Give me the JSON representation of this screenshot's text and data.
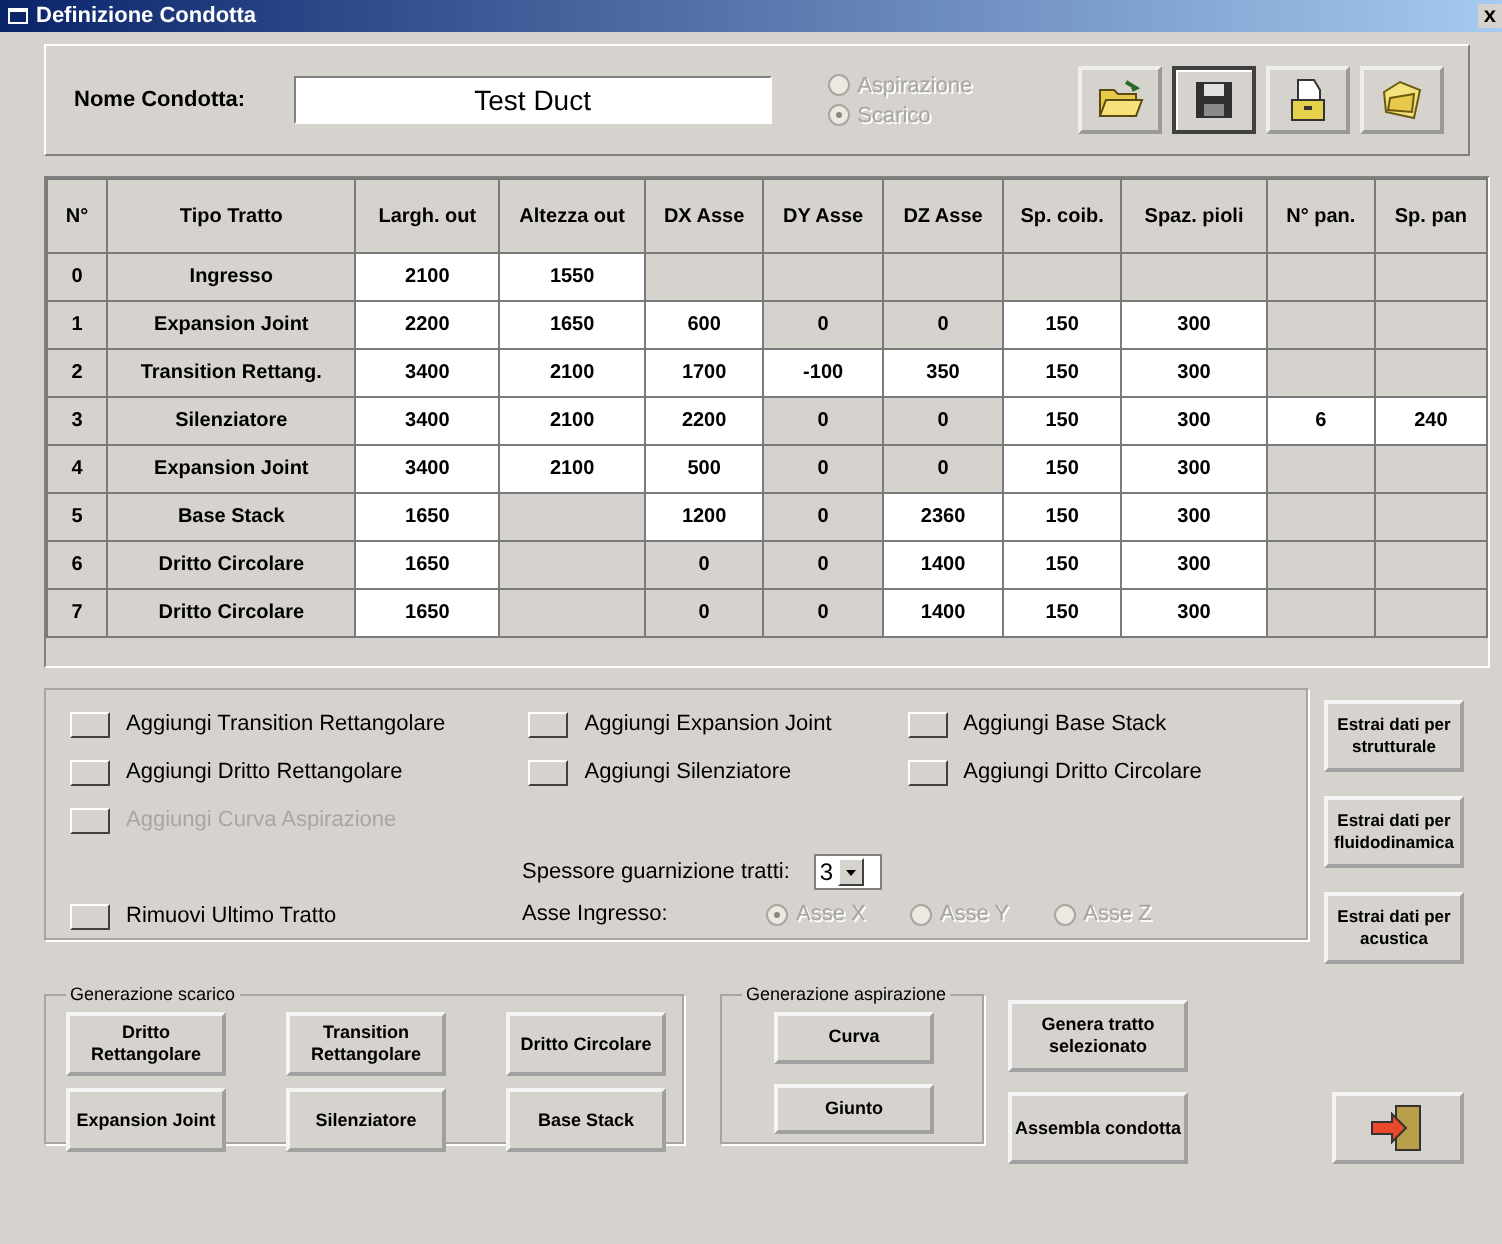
{
  "window": {
    "title": "Definizione Condotta",
    "close": "x"
  },
  "header": {
    "name_label": "Nome Condotta:",
    "name_value": "Test Duct",
    "mode_options": [
      {
        "label": "Aspirazione",
        "selected": false,
        "disabled": true
      },
      {
        "label": "Scarico",
        "selected": true,
        "disabled": true
      }
    ],
    "tool_buttons": [
      {
        "kind": "open",
        "pressed": false
      },
      {
        "kind": "save",
        "pressed": true
      },
      {
        "kind": "archive",
        "pressed": false
      },
      {
        "kind": "folder",
        "pressed": false
      }
    ]
  },
  "table": {
    "columns": [
      "N°",
      "Tipo Tratto",
      "Largh. out",
      "Altezza out",
      "DX Asse",
      "DY Asse",
      "DZ Asse",
      "Sp. coib.",
      "Spaz. pioli",
      "N° pan.",
      "Sp. pan"
    ],
    "rows": [
      {
        "cells": [
          {
            "text": "0",
            "editable": false
          },
          {
            "text": "Ingresso",
            "editable": false
          },
          {
            "text": "2100",
            "editable": true
          },
          {
            "text": "1550",
            "editable": true
          },
          {
            "editable": false
          },
          {
            "editable": false
          },
          {
            "editable": false
          },
          {
            "editable": false
          },
          {
            "editable": false
          },
          {
            "editable": false
          },
          {
            "editable": false
          }
        ]
      },
      {
        "cells": [
          {
            "text": "1",
            "editable": false
          },
          {
            "text": "Expansion Joint",
            "editable": false
          },
          {
            "text": "2200",
            "editable": true
          },
          {
            "text": "1650",
            "editable": true
          },
          {
            "text": "600",
            "editable": true
          },
          {
            "text": "0",
            "editable": false
          },
          {
            "text": "0",
            "editable": false
          },
          {
            "text": "150",
            "editable": true
          },
          {
            "text": "300",
            "editable": true
          },
          {
            "editable": false
          },
          {
            "editable": false
          }
        ]
      },
      {
        "cells": [
          {
            "text": "2",
            "editable": false
          },
          {
            "text": "Transition Rettang.",
            "editable": false
          },
          {
            "text": "3400",
            "editable": true
          },
          {
            "text": "2100",
            "editable": true
          },
          {
            "text": "1700",
            "editable": true
          },
          {
            "text": "-100",
            "editable": true
          },
          {
            "text": "350",
            "editable": true
          },
          {
            "text": "150",
            "editable": true
          },
          {
            "text": "300",
            "editable": true
          },
          {
            "editable": false
          },
          {
            "editable": false
          }
        ]
      },
      {
        "cells": [
          {
            "text": "3",
            "editable": false
          },
          {
            "text": "Silenziatore",
            "editable": false
          },
          {
            "text": "3400",
            "editable": true
          },
          {
            "text": "2100",
            "editable": true
          },
          {
            "text": "2200",
            "editable": true
          },
          {
            "text": "0",
            "editable": false
          },
          {
            "text": "0",
            "editable": false
          },
          {
            "text": "150",
            "editable": true
          },
          {
            "text": "300",
            "editable": true
          },
          {
            "text": "6",
            "editable": true
          },
          {
            "text": "240",
            "editable": true
          }
        ]
      },
      {
        "cells": [
          {
            "text": "4",
            "editable": false
          },
          {
            "text": "Expansion Joint",
            "editable": false
          },
          {
            "text": "3400",
            "editable": true
          },
          {
            "text": "2100",
            "editable": true
          },
          {
            "text": "500",
            "editable": true
          },
          {
            "text": "0",
            "editable": false
          },
          {
            "text": "0",
            "editable": false
          },
          {
            "text": "150",
            "editable": true
          },
          {
            "text": "300",
            "editable": true
          },
          {
            "editable": false
          },
          {
            "editable": false
          }
        ]
      },
      {
        "cells": [
          {
            "text": "5",
            "editable": false
          },
          {
            "text": "Base Stack",
            "editable": false
          },
          {
            "text": "1650",
            "editable": true
          },
          {
            "editable": false
          },
          {
            "text": "1200",
            "editable": true
          },
          {
            "text": "0",
            "editable": false
          },
          {
            "text": "2360",
            "editable": true
          },
          {
            "text": "150",
            "editable": true
          },
          {
            "text": "300",
            "editable": true
          },
          {
            "editable": false
          },
          {
            "editable": false
          }
        ]
      },
      {
        "cells": [
          {
            "text": "6",
            "editable": false
          },
          {
            "text": "Dritto Circolare",
            "editable": false
          },
          {
            "text": "1650",
            "editable": true
          },
          {
            "editable": false
          },
          {
            "text": "0",
            "editable": false
          },
          {
            "text": "0",
            "editable": false
          },
          {
            "text": "1400",
            "editable": true
          },
          {
            "text": "150",
            "editable": true
          },
          {
            "text": "300",
            "editable": true
          },
          {
            "editable": false
          },
          {
            "editable": false
          }
        ]
      },
      {
        "cells": [
          {
            "text": "7",
            "editable": false
          },
          {
            "text": "Dritto Circolare",
            "editable": false
          },
          {
            "text": "1650",
            "editable": true
          },
          {
            "editable": false
          },
          {
            "text": "0",
            "editable": false
          },
          {
            "text": "0",
            "editable": false
          },
          {
            "text": "1400",
            "editable": true
          },
          {
            "text": "150",
            "editable": true
          },
          {
            "text": "300",
            "editable": true
          },
          {
            "editable": false
          },
          {
            "editable": false
          }
        ]
      }
    ]
  },
  "actions": [
    [
      {
        "label": "Aggiungi Transition Rettangolare",
        "disabled": false
      },
      {
        "label": "Aggiungi Dritto Rettangolare",
        "disabled": false
      },
      {
        "label": "Aggiungi Curva Aspirazione",
        "disabled": true
      }
    ],
    [
      {
        "label": "Aggiungi Expansion Joint",
        "disabled": false
      },
      {
        "label": "Aggiungi Silenziatore",
        "disabled": false
      }
    ],
    [
      {
        "label": "Aggiungi Base Stack",
        "disabled": false
      },
      {
        "label": "Aggiungi Dritto Circolare",
        "disabled": false
      }
    ]
  ],
  "remove_action": {
    "label": "Rimuovi Ultimo Tratto",
    "disabled": false
  },
  "gasket": {
    "label": "Spessore guarnizione tratti:",
    "value": "3"
  },
  "inlet_axis": {
    "label": "Asse Ingresso:",
    "options": [
      {
        "label": "Asse X",
        "selected": true,
        "disabled": true
      },
      {
        "label": "Asse Y",
        "selected": false,
        "disabled": true
      },
      {
        "label": "Asse Z",
        "selected": false,
        "disabled": true
      }
    ]
  },
  "extract_buttons": [
    "Estrai dati per strutturale",
    "Estrai dati per fluidodinamica",
    "Estrai dati per acustica"
  ],
  "exhaust_group": {
    "title": "Generazione scarico",
    "buttons": [
      "Dritto Rettangolare",
      "Transition Rettangolare",
      "Dritto Circolare",
      "Expansion Joint",
      "Silenziatore",
      "Base Stack"
    ]
  },
  "intake_group": {
    "title": "Generazione aspirazione",
    "buttons": [
      "Curva",
      "Giunto"
    ]
  },
  "side_buttons": [
    "Genera tratto selezionato",
    "Assembla condotta"
  ]
}
